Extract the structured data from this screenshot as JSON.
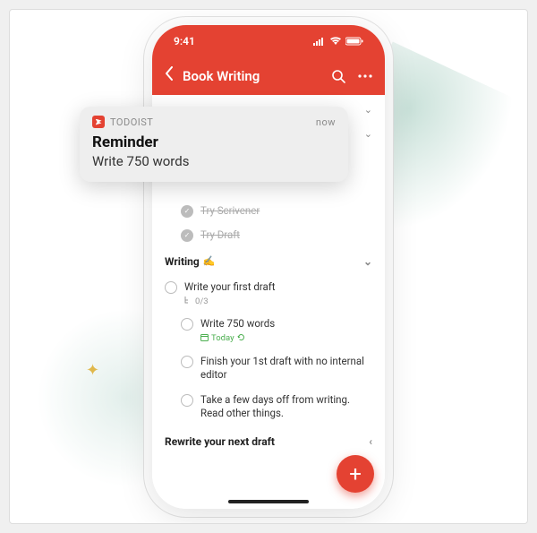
{
  "status": {
    "time": "9:41"
  },
  "nav": {
    "title": "Book Writing"
  },
  "notification": {
    "app_name": "TODOIST",
    "time_label": "now",
    "title": "Reminder",
    "body": "Write 750 words"
  },
  "tasks": {
    "completed": [
      {
        "title": "Try Scrivener"
      },
      {
        "title": "Try Draft"
      }
    ],
    "section_writing": {
      "label": "Writing",
      "emoji": "✍️"
    },
    "first_draft": {
      "title": "Write your first draft",
      "subtask_count": "0/3",
      "children": [
        {
          "title": "Write 750 words",
          "date_label": "Today"
        },
        {
          "title": "Finish your 1st draft with no internal editor"
        },
        {
          "title": "Take a few days off from writing. Read other things."
        }
      ]
    },
    "rewrite": {
      "label": "Rewrite your next draft"
    }
  },
  "fab": {
    "label": "+"
  }
}
